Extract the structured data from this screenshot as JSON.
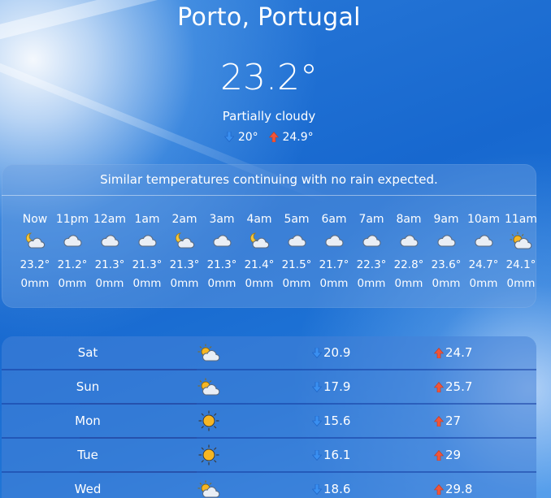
{
  "location": "Porto, Portugal",
  "current": {
    "temperature": "23.2°",
    "condition": "Partially cloudy",
    "low": "20°",
    "high": "24.9°"
  },
  "hourly": {
    "summary": "Similar temperatures continuing with no rain expected.",
    "hours": [
      {
        "time": "Now",
        "icon": "partly-cloudy-night-icon",
        "temp": "23.2°",
        "rain": "0mm"
      },
      {
        "time": "11pm",
        "icon": "cloud-icon",
        "temp": "21.2°",
        "rain": "0mm"
      },
      {
        "time": "12am",
        "icon": "cloud-icon",
        "temp": "21.3°",
        "rain": "0mm"
      },
      {
        "time": "1am",
        "icon": "cloud-icon",
        "temp": "21.3°",
        "rain": "0mm"
      },
      {
        "time": "2am",
        "icon": "partly-cloudy-night-icon",
        "temp": "21.3°",
        "rain": "0mm"
      },
      {
        "time": "3am",
        "icon": "cloud-icon",
        "temp": "21.3°",
        "rain": "0mm"
      },
      {
        "time": "4am",
        "icon": "partly-cloudy-night-icon",
        "temp": "21.4°",
        "rain": "0mm"
      },
      {
        "time": "5am",
        "icon": "cloud-icon",
        "temp": "21.5°",
        "rain": "0mm"
      },
      {
        "time": "6am",
        "icon": "cloud-icon",
        "temp": "21.7°",
        "rain": "0mm"
      },
      {
        "time": "7am",
        "icon": "cloud-icon",
        "temp": "22.3°",
        "rain": "0mm"
      },
      {
        "time": "8am",
        "icon": "cloud-icon",
        "temp": "22.8°",
        "rain": "0mm"
      },
      {
        "time": "9am",
        "icon": "cloud-icon",
        "temp": "23.6°",
        "rain": "0mm"
      },
      {
        "time": "10am",
        "icon": "cloud-icon",
        "temp": "24.7°",
        "rain": "0mm"
      },
      {
        "time": "11am",
        "icon": "partly-cloudy-day-icon",
        "temp": "24.1°",
        "rain": "0mm"
      }
    ]
  },
  "daily": [
    {
      "day": "Sat",
      "icon": "partly-cloudy-day-icon",
      "low": "20.9",
      "high": "24.7"
    },
    {
      "day": "Sun",
      "icon": "partly-cloudy-day-icon",
      "low": "17.9",
      "high": "25.7"
    },
    {
      "day": "Mon",
      "icon": "sun-icon",
      "low": "15.6",
      "high": "27"
    },
    {
      "day": "Tue",
      "icon": "sun-icon",
      "low": "16.1",
      "high": "29"
    },
    {
      "day": "Wed",
      "icon": "partly-cloudy-day-icon",
      "low": "18.6",
      "high": "29.8"
    }
  ],
  "colors": {
    "down_arrow": "#3a8ff0",
    "up_arrow": "#f0553a",
    "sun": "#f6b623"
  }
}
